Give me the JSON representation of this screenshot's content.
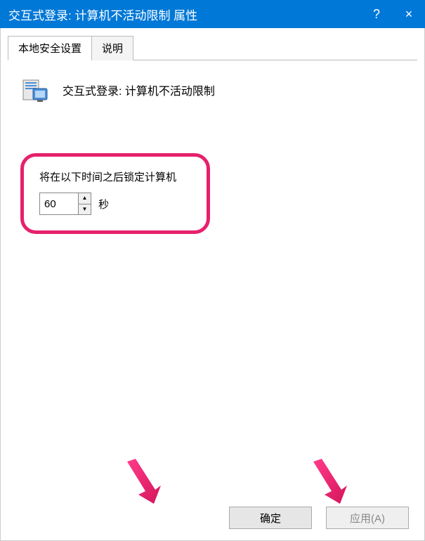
{
  "titlebar": {
    "title": "交互式登录: 计算机不活动限制 属性",
    "help": "?",
    "close": "×"
  },
  "tabs": [
    {
      "label": "本地安全设置",
      "active": true
    },
    {
      "label": "说明",
      "active": false
    }
  ],
  "policy": {
    "name": "交互式登录: 计算机不活动限制"
  },
  "lock": {
    "label": "将在以下时间之后锁定计算机",
    "value": "60",
    "unit": "秒"
  },
  "buttons": {
    "ok": "确定",
    "apply": "应用(A)"
  }
}
